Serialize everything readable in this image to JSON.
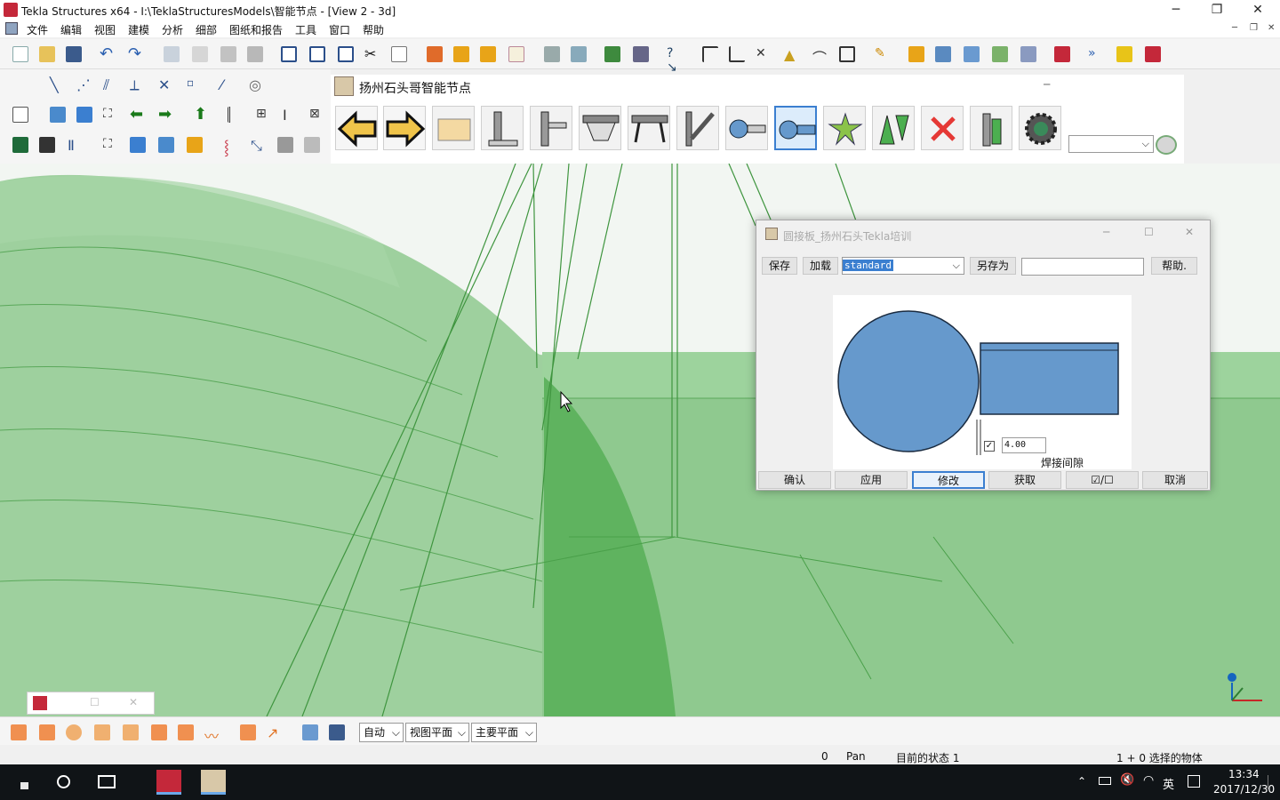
{
  "window": {
    "title": "Tekla Structures x64 - I:\\TeklaStructuresModels\\智能节点 - [View 2 - 3d]",
    "minimize": "─",
    "maximize": "❐",
    "close": "✕"
  },
  "menu": [
    "文件",
    "编辑",
    "视图",
    "建模",
    "分析",
    "细部",
    "图纸和报告",
    "工具",
    "窗口",
    "帮助"
  ],
  "node_toolbar": {
    "title": "扬州石头哥智能节点",
    "buttons": [
      "previous-arrow",
      "next-arrow",
      "plate",
      "column-base",
      "column-stiffener",
      "beam-haunch",
      "beam-splice",
      "brace",
      "pipe-plate",
      "pipe-tube",
      "gusset-star",
      "triangle-stiffener",
      "delete",
      "column-splice",
      "settings-gear"
    ]
  },
  "dialog": {
    "title": "圆接板_扬州石头Tekla培训",
    "save": "保存",
    "load": "加载",
    "preset": "standard",
    "save_as": "另存为",
    "save_as_value": "",
    "help": "帮助.",
    "weld_gap_label": "焊接间隙",
    "weld_gap_value": "4.00",
    "ok": "确认",
    "apply": "应用",
    "modify": "修改",
    "get": "获取",
    "toggle_check": "☑",
    "toggle_slash": "/",
    "toggle_uncheck": "☐",
    "cancel": "取消",
    "colors": {
      "shape": "#6699cc",
      "stroke": "#1a2b40"
    }
  },
  "bottom": {
    "select_mode": "自动",
    "plane": "视图平面",
    "main_plane": "主要平面"
  },
  "status": {
    "count": "0",
    "command": "Pan",
    "state": "目前的状态 1",
    "selected": "1 + 0 选择的物体"
  },
  "taskbar": {
    "time": "13:34",
    "date": "2017/12/30",
    "ime": "英"
  },
  "colors": {
    "model_green": "#6dbd6d",
    "accent": "#3b7fd0"
  }
}
